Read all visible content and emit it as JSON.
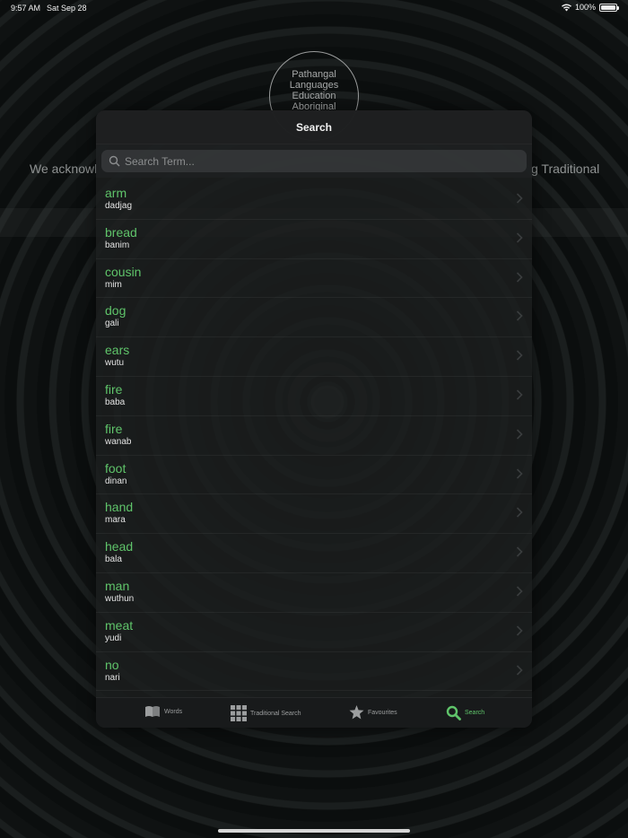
{
  "status_bar": {
    "time": "9:57 AM",
    "date": "Sat Sep 28",
    "battery": "100%"
  },
  "logo_lines": [
    "Pathangal",
    "Languages",
    "Education",
    "Aboriginal"
  ],
  "acknowledgement": {
    "left": "We acknowl",
    "right": "g Traditional"
  },
  "modal": {
    "title": "Search",
    "search_placeholder": "Search Term...",
    "search_value": ""
  },
  "words": [
    {
      "word": "arm",
      "translation": "dadjag"
    },
    {
      "word": "bread",
      "translation": "banim"
    },
    {
      "word": "cousin",
      "translation": "mim"
    },
    {
      "word": "dog",
      "translation": "gali"
    },
    {
      "word": "ears",
      "translation": "wutu"
    },
    {
      "word": "fire",
      "translation": "baba"
    },
    {
      "word": "fire",
      "translation": "wanab"
    },
    {
      "word": "foot",
      "translation": "dinan"
    },
    {
      "word": "hand",
      "translation": "mara"
    },
    {
      "word": "head",
      "translation": "bala"
    },
    {
      "word": "man",
      "translation": "wuthun"
    },
    {
      "word": "meat",
      "translation": "yudi"
    },
    {
      "word": "no",
      "translation": "nari"
    }
  ],
  "tabs": [
    {
      "label": "Words",
      "icon": "book-icon",
      "active": false
    },
    {
      "label": "Traditional Search",
      "icon": "grid-icon",
      "active": false
    },
    {
      "label": "Favourites",
      "icon": "star-icon",
      "active": false
    },
    {
      "label": "Search",
      "icon": "search-icon",
      "active": true
    }
  ],
  "colors": {
    "accent": "#5fc46a",
    "panel": "#1c1e1f",
    "text": "#e4e4e4"
  }
}
